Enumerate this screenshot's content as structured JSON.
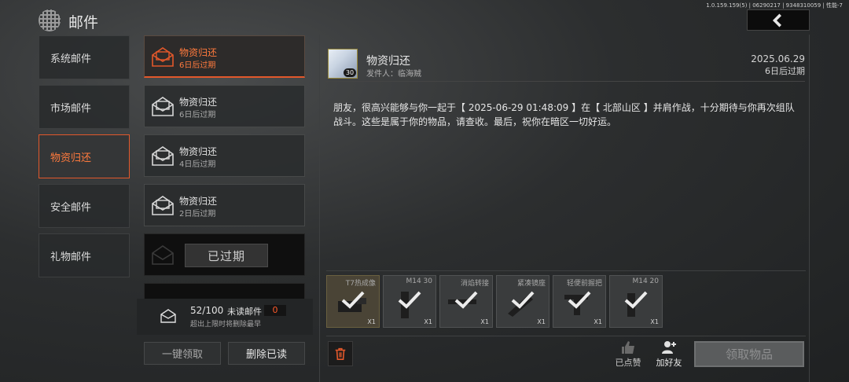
{
  "header": {
    "title": "邮件",
    "build_info": "1.0.159.159(5) | 06290217 | 9348310059 | 性能-7"
  },
  "categories": [
    {
      "label": "系统邮件",
      "active": false
    },
    {
      "label": "市场邮件",
      "active": false
    },
    {
      "label": "物资归还",
      "active": true
    },
    {
      "label": "安全邮件",
      "active": false
    },
    {
      "label": "礼物邮件",
      "active": false
    }
  ],
  "mail_list": [
    {
      "title": "物资归还",
      "sub": "6日后过期",
      "state": "active"
    },
    {
      "title": "物资归还",
      "sub": "6日后过期",
      "state": "normal"
    },
    {
      "title": "物资归还",
      "sub": "4日后过期",
      "state": "normal"
    },
    {
      "title": "物资归还",
      "sub": "2日后过期",
      "state": "normal"
    },
    {
      "title": "",
      "sub": "",
      "state": "expired",
      "expired_label": "已过期"
    }
  ],
  "counter": {
    "count": "52/100",
    "label": "未读邮件",
    "unread": "0",
    "note": "超出上限时将删除最早"
  },
  "list_buttons": {
    "claim_all": "一键领取",
    "delete_read": "删除已读"
  },
  "detail": {
    "tiny_left": "",
    "tiny_right": "",
    "title": "物资归还",
    "sender": "发件人：临海贼",
    "avatar_level": "30",
    "date": "2025.06.29",
    "expire": "6日后过期",
    "body": "朋友，很高兴能够与你一起于【 2025-06-29 01:48:09 】在【 北部山区 】并肩作战，十分期待与你再次组队战斗。这些是属于你的物品，请查收。最后，祝你在暗区一切好运。"
  },
  "attachments": [
    {
      "name": "T7热成像",
      "qty": "X1",
      "gold": true
    },
    {
      "name": "M14 30",
      "qty": "X1",
      "gold": false
    },
    {
      "name": "消焰转接",
      "qty": "X1",
      "gold": false
    },
    {
      "name": "紧凑镜座",
      "qty": "X1",
      "gold": false
    },
    {
      "name": "轻便前握把",
      "qty": "X1",
      "gold": false
    },
    {
      "name": "M14 20",
      "qty": "X1",
      "gold": false
    }
  ],
  "actions": {
    "liked": "已点赞",
    "add_friend": "加好友",
    "claim": "领取物品"
  },
  "icons": {
    "back": "chevron-left-icon",
    "mail": "envelope-icon",
    "trash": "trash-icon",
    "like": "thumbs-up-icon",
    "add_friend": "add-user-icon",
    "check": "checkmark-icon"
  },
  "colors": {
    "accent": "#e2582b",
    "accent_text": "#ff7a3d",
    "unread": "#ff5a2a"
  }
}
